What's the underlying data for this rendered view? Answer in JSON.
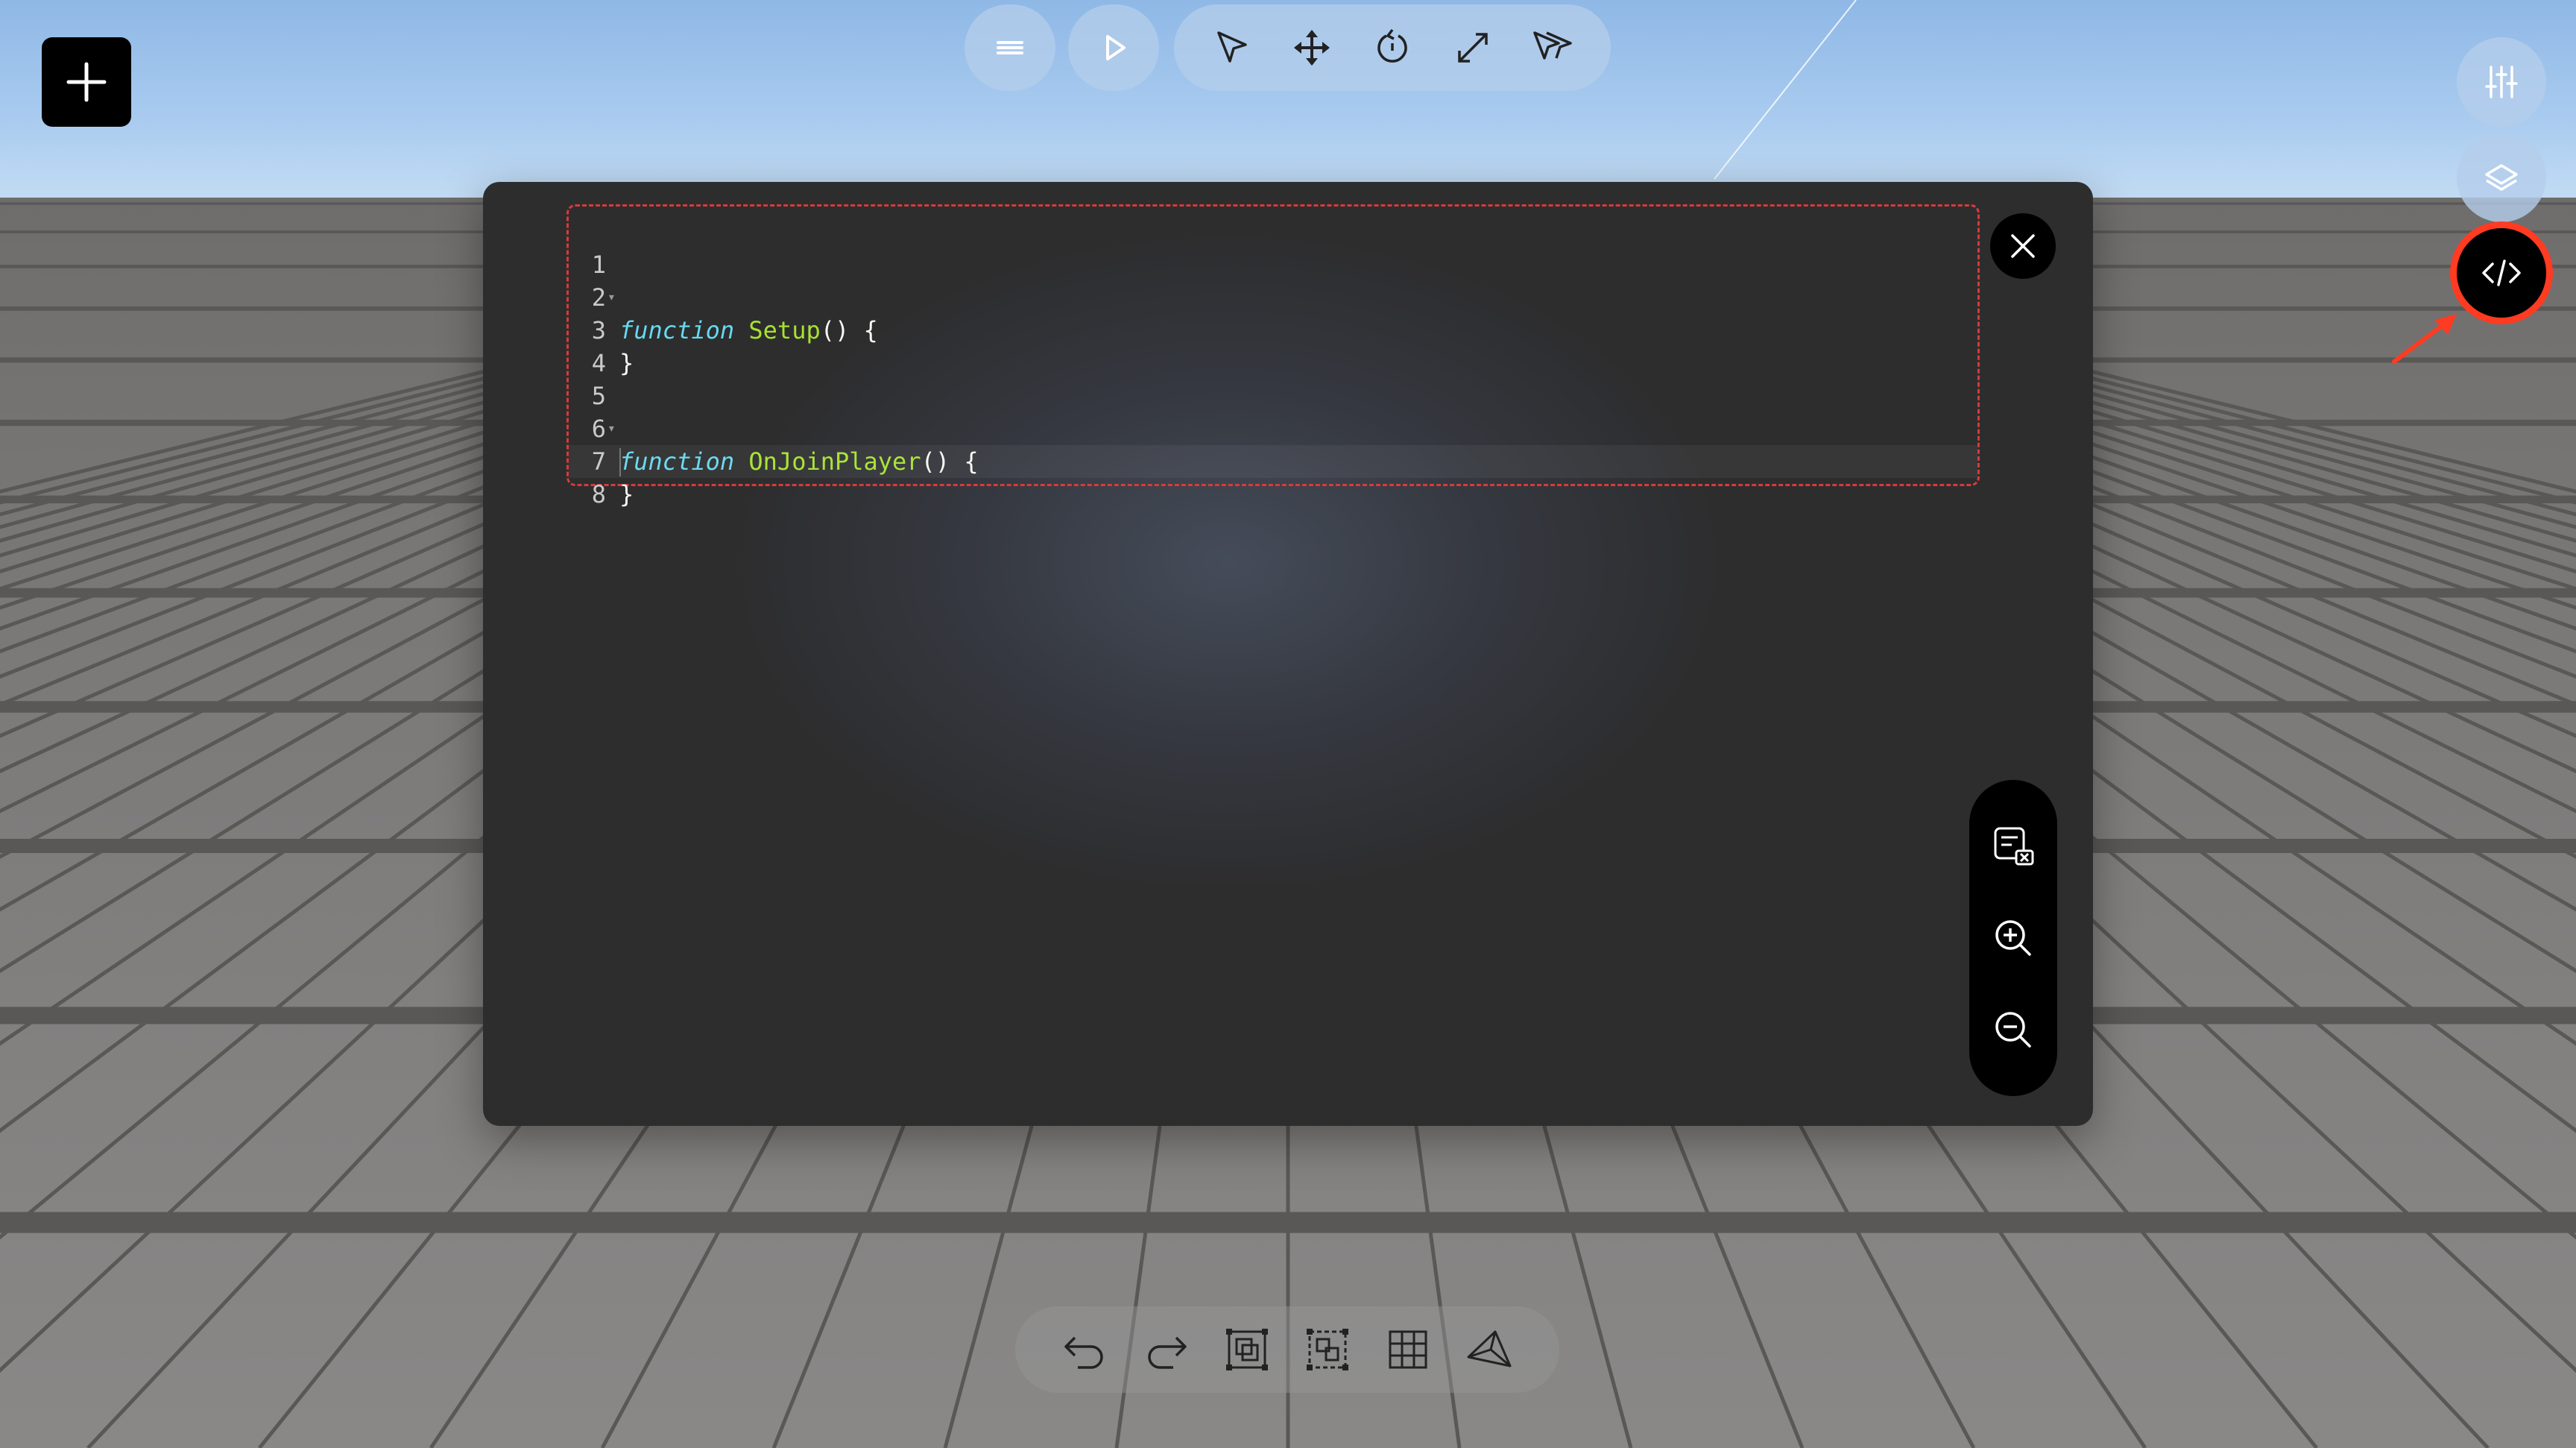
{
  "toolbar": {
    "left": {
      "add": "plus-icon"
    },
    "top": [
      "menu-icon",
      "play-icon",
      "select-icon",
      "move-icon",
      "rotate-icon",
      "scale-icon",
      "multi-select-icon"
    ],
    "right": [
      "settings-sliders-icon",
      "layers-icon",
      "code-icon"
    ],
    "bottom": [
      "undo-icon",
      "redo-icon",
      "duplicate-icon",
      "group-icon",
      "grid-icon",
      "camera-icon"
    ]
  },
  "editor": {
    "lines": [
      {
        "num": "1",
        "fold": "▾",
        "keyword": "function",
        "name": "Setup",
        "rest": "() {"
      },
      {
        "num": "2",
        "fold": "",
        "keyword": "",
        "name": "",
        "rest": ""
      },
      {
        "num": "3",
        "fold": "",
        "keyword": "",
        "name": "",
        "rest": "}"
      },
      {
        "num": "4",
        "fold": "",
        "keyword": "",
        "name": "",
        "rest": ""
      },
      {
        "num": "5",
        "fold": "▾",
        "keyword": "function",
        "name": "OnJoinPlayer",
        "rest": "() {"
      },
      {
        "num": "6",
        "fold": "",
        "keyword": "",
        "name": "",
        "rest": ""
      },
      {
        "num": "7",
        "fold": "",
        "keyword": "",
        "name": "",
        "rest": "}"
      },
      {
        "num": "8",
        "fold": "",
        "keyword": "",
        "name": "",
        "rest": ""
      }
    ],
    "active_line": 8,
    "side_tools": [
      "clear-console-icon",
      "zoom-in-icon",
      "zoom-out-icon"
    ]
  },
  "colors": {
    "keyword": "#66d9ef",
    "function_name": "#a6e22e",
    "highlight": "#ff3b22"
  }
}
